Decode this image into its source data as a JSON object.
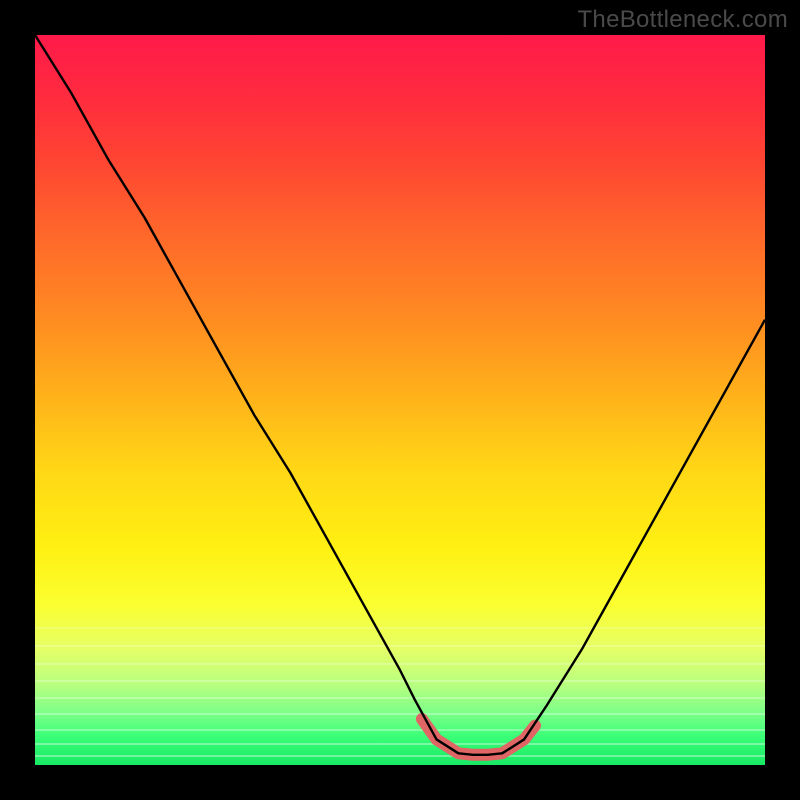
{
  "watermark": "TheBottleneck.com",
  "colors": {
    "highlight_stroke": "#e06666",
    "curve_stroke": "#000000",
    "stripe_fill": "#ffffff"
  },
  "chart_data": {
    "type": "line",
    "title": "",
    "xlabel": "",
    "ylabel": "",
    "xlim": [
      0,
      100
    ],
    "ylim": [
      0,
      100
    ],
    "legend": false,
    "grid": false,
    "series": [
      {
        "name": "bottleneck-curve",
        "x": [
          0,
          5,
          10,
          15,
          20,
          25,
          30,
          35,
          40,
          45,
          50,
          52,
          55,
          58,
          60,
          62,
          64,
          67,
          70,
          75,
          80,
          85,
          90,
          95,
          100
        ],
        "y": [
          100,
          92,
          83,
          75,
          66,
          57,
          48,
          40,
          31,
          22,
          13,
          9,
          3.5,
          1.6,
          1.4,
          1.4,
          1.6,
          3.5,
          8,
          16,
          25,
          34,
          43,
          52,
          61
        ]
      },
      {
        "name": "highlight-zone",
        "x": [
          53,
          55,
          58,
          60,
          62,
          64,
          67,
          68.5
        ],
        "y": [
          6.3,
          3.5,
          1.6,
          1.4,
          1.4,
          1.6,
          3.5,
          5.4
        ]
      }
    ],
    "annotations": []
  }
}
